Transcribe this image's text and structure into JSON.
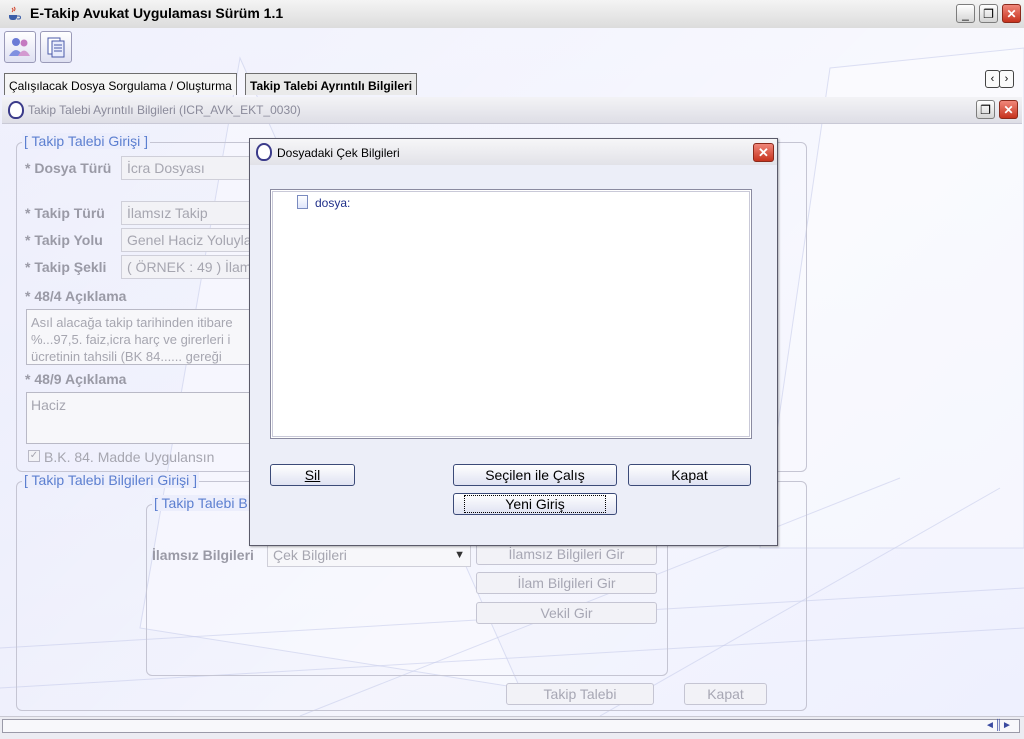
{
  "window": {
    "title": "E-Takip Avukat Uygulaması Sürüm 1.1",
    "controls": {
      "minimize": "_",
      "maximize": "❐",
      "close": "✕"
    }
  },
  "toolbar": {
    "icons": [
      "users-icon",
      "documents-icon"
    ]
  },
  "tabs": [
    {
      "label": "Çalışılacak Dosya Sorgulama / Oluşturma",
      "active": false
    },
    {
      "label": "Takip Talebi Ayrıntılı Bilgileri",
      "active": true
    }
  ],
  "tab_nav": {
    "prev": "‹",
    "next": "›"
  },
  "inner_frame": {
    "title": "Takip Talebi Ayrıntılı Bilgileri (ICR_AVK_EKT_0030)"
  },
  "form": {
    "section1_title": "[ Takip Talebi Girişi ]",
    "dosya_turu_label": "* Dosya Türü",
    "dosya_turu_value": "İcra Dosyası",
    "takip_turu_label": "* Takip Türü",
    "takip_turu_value": "İlamsız Takip",
    "takip_yolu_label": "* Takip Yolu",
    "takip_yolu_value": "Genel Haciz Yoluyla",
    "takip_sekli_label": "* Takip Şekli",
    "takip_sekli_value": "( ÖRNEK  : 49 ) İlam",
    "aciklama_484_label": "* 48/4 Açıklama",
    "aciklama_484_line1": "Asıl alacağa takip tarihinden itibare",
    "aciklama_484_line2": "%...97,5. faiz,icra harç ve girerleri i",
    "aciklama_484_line3": "ücretinin tahsili (BK 84...... gereği",
    "aciklama_489_label": "* 48/9 Açıklama",
    "aciklama_489_value": "Haciz",
    "bk84_label": "B.K. 84. Madde Uygulansın",
    "section2_title": "[ Takip Talebi Bilgileri Girişi ]",
    "subsection_title": "[ Takip Talebi B",
    "ilamsiz_label": "İlamsız Bilgileri",
    "ilamsiz_select": "Çek Bilgileri",
    "btn_ilamsiz": "İlamsız Bilgileri Gir",
    "btn_ilam": "İlam Bilgileri Gir",
    "btn_vekil": "Vekil Gir",
    "btn_takip": "Takip Talebi",
    "btn_kapat": "Kapat"
  },
  "dialog": {
    "title": "Dosyadaki Çek Bilgileri",
    "tree_item": "dosya:",
    "btn_sil": "Sil",
    "btn_secilen": "Seçilen ile Çalış",
    "btn_kapat": "Kapat",
    "btn_yeni": "Yeni Giriş"
  },
  "status_bar": {
    "indicator": "◄║►"
  }
}
